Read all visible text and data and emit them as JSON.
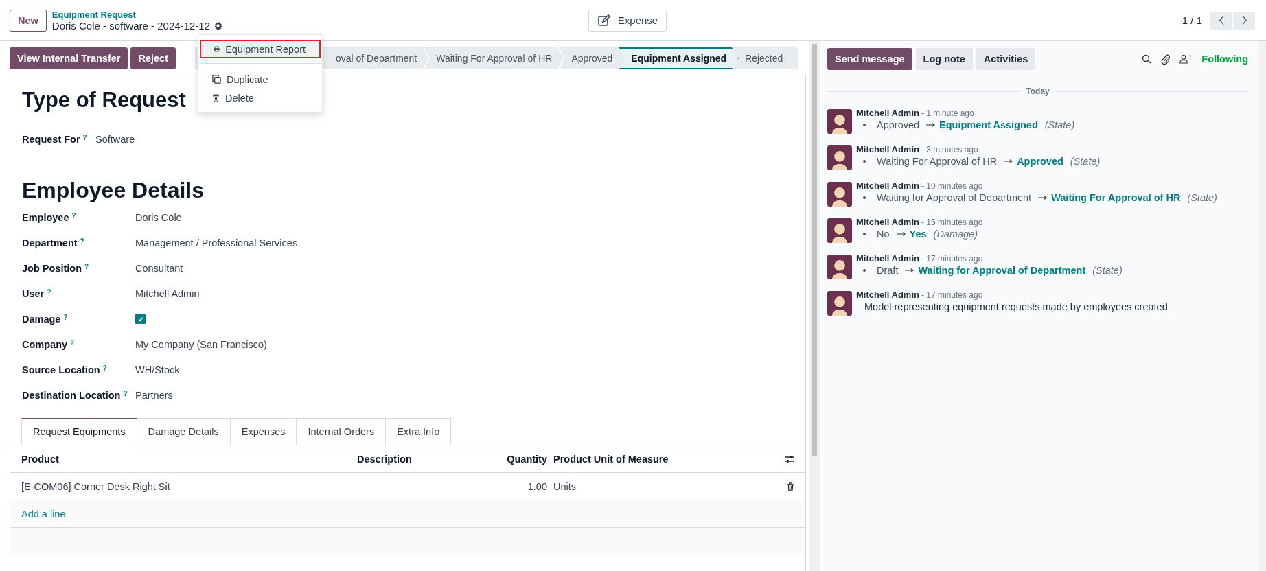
{
  "header": {
    "new_button": "New",
    "breadcrumb": "Equipment Request",
    "record_name": "Doris Cole - software - 2024-12-12",
    "smart_button": "Expense",
    "pager": "1 / 1"
  },
  "action_menu": {
    "items": [
      {
        "label": "Equipment Report",
        "kind": "print",
        "highlighted": true
      },
      {
        "label": "Duplicate",
        "kind": "duplicate",
        "highlighted": false
      },
      {
        "label": "Delete",
        "kind": "delete",
        "highlighted": false
      }
    ]
  },
  "action_buttons": [
    "View Internal Transfer",
    "Reject"
  ],
  "stages": [
    {
      "label": "oval of Department",
      "selected": false
    },
    {
      "label": "Waiting For Approval of HR",
      "selected": false
    },
    {
      "label": "Approved",
      "selected": false
    },
    {
      "label": "Equipment Assigned",
      "selected": true
    },
    {
      "label": "Rejected",
      "selected": false
    }
  ],
  "form": {
    "title": "Type of Request",
    "request_for": {
      "label": "Request For",
      "help": "?",
      "value": "Software"
    },
    "section_title": "Employee Details",
    "fields": [
      {
        "label": "Employee",
        "help": "?",
        "kind": "text",
        "value": "Doris Cole"
      },
      {
        "label": "Department",
        "help": "?",
        "kind": "text",
        "value": "Management / Professional Services"
      },
      {
        "label": "Job Position",
        "help": "?",
        "kind": "text",
        "value": "Consultant"
      },
      {
        "label": "User",
        "help": "?",
        "kind": "text",
        "value": "Mitchell Admin"
      },
      {
        "label": "Damage",
        "help": "?",
        "kind": "checkbox",
        "checked": true
      },
      {
        "label": "Company",
        "help": "?",
        "kind": "text",
        "value": "My Company (San Francisco)"
      },
      {
        "label": "Source Location",
        "help": "?",
        "kind": "text",
        "value": "WH/Stock"
      },
      {
        "label": "Destination Location",
        "help": "?",
        "kind": "text",
        "value": "Partners"
      }
    ]
  },
  "tabs": [
    {
      "label": "Request Equipments",
      "selected": true
    },
    {
      "label": "Damage Details",
      "selected": false
    },
    {
      "label": "Expenses",
      "selected": false
    },
    {
      "label": "Internal Orders",
      "selected": false
    },
    {
      "label": "Extra Info",
      "selected": false
    }
  ],
  "table": {
    "columns": [
      "Product",
      "Description",
      "Quantity",
      "Product Unit of Measure"
    ],
    "rows": [
      {
        "product": "[E-COM06] Corner Desk Right Sit",
        "description": "",
        "quantity": "1.00",
        "uom": "Units"
      }
    ],
    "add_line": "Add a line"
  },
  "chatter": {
    "buttons": [
      {
        "label": "Send message",
        "selected": true
      },
      {
        "label": "Log note",
        "selected": false
      },
      {
        "label": "Activities",
        "selected": false
      }
    ],
    "follower_count": "1",
    "following": "Following",
    "day": "Today",
    "messages": [
      {
        "author": "Mitchell Admin",
        "time": "- 1 minute ago",
        "kind": "tracking",
        "old": "Approved",
        "new": "Equipment Assigned",
        "field": "(State)"
      },
      {
        "author": "Mitchell Admin",
        "time": "- 3 minutes ago",
        "kind": "tracking",
        "old": "Waiting For Approval of HR",
        "new": "Approved",
        "field": "(State)"
      },
      {
        "author": "Mitchell Admin",
        "time": "- 10 minutes ago",
        "kind": "tracking",
        "old": "Waiting for Approval of Department",
        "new": "Waiting For Approval of HR",
        "field": "(State)"
      },
      {
        "author": "Mitchell Admin",
        "time": "- 15 minutes ago",
        "kind": "tracking",
        "old": "No",
        "new": "Yes",
        "field": "(Damage)"
      },
      {
        "author": "Mitchell Admin",
        "time": "- 17 minutes ago",
        "kind": "tracking",
        "old": "Draft",
        "new": "Waiting for Approval of Department",
        "field": "(State)"
      },
      {
        "author": "Mitchell Admin",
        "time": "- 17 minutes ago",
        "kind": "note",
        "body": "Model representing equipment requests made by employees created"
      }
    ]
  }
}
